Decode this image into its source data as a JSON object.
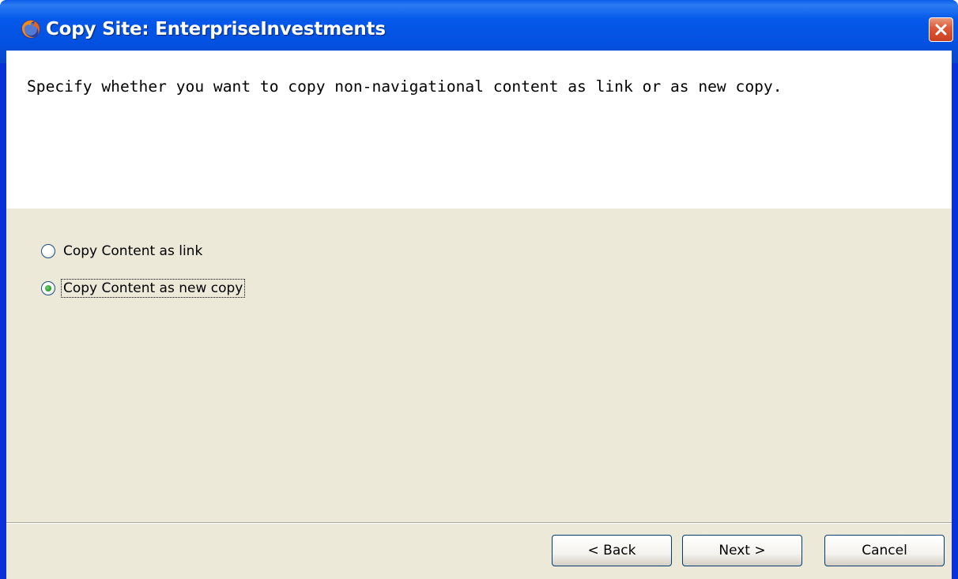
{
  "window": {
    "title": "Copy Site: EnterpriseInvestments"
  },
  "instruction_text": "Specify whether you want to copy non-navigational content as link or as new copy.",
  "options": [
    {
      "label": "Copy Content as link",
      "checked": false
    },
    {
      "label": "Copy Content as new copy",
      "checked": true
    }
  ],
  "buttons": {
    "back": "< Back",
    "next": "Next >",
    "cancel": "Cancel"
  }
}
